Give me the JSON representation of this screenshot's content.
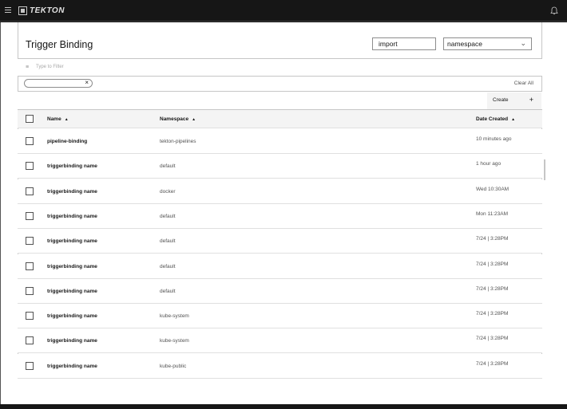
{
  "topbar": {
    "logo_text": "TEKTON",
    "menu_icon": "hamburger-icon",
    "notification_icon": "bell-icon"
  },
  "page": {
    "title": "Trigger Binding"
  },
  "controls": {
    "import_label": "import",
    "namespace_value": "namespace"
  },
  "filter": {
    "placeholder": "Type to Filter",
    "clear_all": "Clear All"
  },
  "toolbar": {
    "create_label": "Create",
    "create_icon": "+"
  },
  "table": {
    "headers": {
      "name": "Name",
      "namespace": "Namespace",
      "date": "Date Created"
    },
    "rows": [
      {
        "name": "pipeline-binding",
        "namespace": "tekton-pipelines",
        "date": "10 minutes ago"
      },
      {
        "name": "triggerbinding name",
        "namespace": "default",
        "date": "1 hour ago"
      },
      {
        "name": "triggerbinding name",
        "namespace": "docker",
        "date": "Wed 10:30AM"
      },
      {
        "name": "triggerbinding name",
        "namespace": "default",
        "date": "Mon 11:23AM"
      },
      {
        "name": "triggerbinding name",
        "namespace": "default",
        "date": "7/24 | 3:28PM"
      },
      {
        "name": "triggerbinding name",
        "namespace": "default",
        "date": "7/24 | 3:28PM"
      },
      {
        "name": "triggerbinding name",
        "namespace": "default",
        "date": "7/24 | 3:28PM"
      },
      {
        "name": "triggerbinding name",
        "namespace": "kube-system",
        "date": "7/24 | 3:28PM"
      },
      {
        "name": "triggerbinding name",
        "namespace": "kube-system",
        "date": "7/24 | 3:28PM"
      },
      {
        "name": "triggerbinding name",
        "namespace": "kube-public",
        "date": "7/24 | 3:28PM"
      }
    ]
  }
}
